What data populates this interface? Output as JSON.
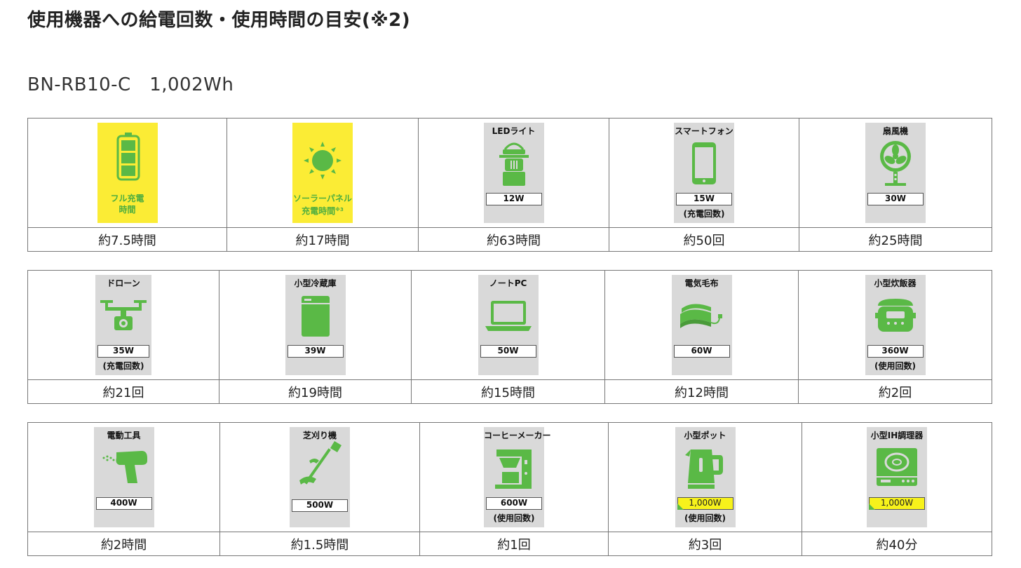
{
  "page_title": "使用機器への給電回数・使用時間の目安(※2)",
  "model_line": "BN-RB10-C　1,002Wh",
  "rows": [
    [
      {
        "id": "full-charge",
        "icon": "battery-icon",
        "caption1": "フル充電",
        "caption2": "時間",
        "value": "約7.5時間"
      },
      {
        "id": "solar",
        "icon": "sun-icon",
        "caption1": "ソーラーパネル",
        "caption2": "充電時間",
        "caption_sup": "※3",
        "value": "約17時間"
      },
      {
        "id": "led-light",
        "icon": "lantern-icon",
        "label": "LEDライト",
        "watt": "12W",
        "value": "約63時間"
      },
      {
        "id": "smartphone",
        "icon": "smartphone-icon",
        "label": "スマートフォン",
        "watt": "15W",
        "note": "(充電回数)",
        "value": "約50回"
      },
      {
        "id": "fan",
        "icon": "fan-icon",
        "label": "扇風機",
        "watt": "30W",
        "value": "約25時間"
      }
    ],
    [
      {
        "id": "drone",
        "icon": "drone-icon",
        "label": "ドローン",
        "watt": "35W",
        "note": "(充電回数)",
        "value": "約21回"
      },
      {
        "id": "fridge",
        "icon": "fridge-icon",
        "label": "小型冷蔵庫",
        "watt": "39W",
        "value": "約19時間"
      },
      {
        "id": "laptop",
        "icon": "laptop-icon",
        "label": "ノートPC",
        "watt": "50W",
        "value": "約15時間"
      },
      {
        "id": "blanket",
        "icon": "electric-blanket-icon",
        "label": "電気毛布",
        "watt": "60W",
        "value": "約12時間"
      },
      {
        "id": "rice-cooker",
        "icon": "rice-cooker-icon",
        "label": "小型炊飯器",
        "watt": "360W",
        "note": "(使用回数)",
        "value": "約2回"
      }
    ],
    [
      {
        "id": "power-tool",
        "icon": "drill-icon",
        "label": "電動工具",
        "watt": "400W",
        "value": "約2時間"
      },
      {
        "id": "trimmer",
        "icon": "grass-trimmer-icon",
        "label": "芝刈り機",
        "watt": "500W",
        "value": "約1.5時間"
      },
      {
        "id": "coffee",
        "icon": "coffee-maker-icon",
        "label": "コーヒーメーカー",
        "watt": "600W",
        "note": "(使用回数)",
        "value": "約1回"
      },
      {
        "id": "kettle",
        "icon": "kettle-icon",
        "label": "小型ポット",
        "watt": "1,000W",
        "watt_highlight": true,
        "note": "(使用回数)",
        "value": "約3回"
      },
      {
        "id": "ih",
        "icon": "ih-cooker-icon",
        "label": "小型IH調理器",
        "watt": "1,000W",
        "watt_highlight": true,
        "value": "約40分"
      }
    ]
  ],
  "colors": {
    "accent_green": "#5ab946",
    "tile_gray": "#d9d9d9",
    "tile_yellow": "#fbec35",
    "watt_highlight": "#f7f21b"
  }
}
